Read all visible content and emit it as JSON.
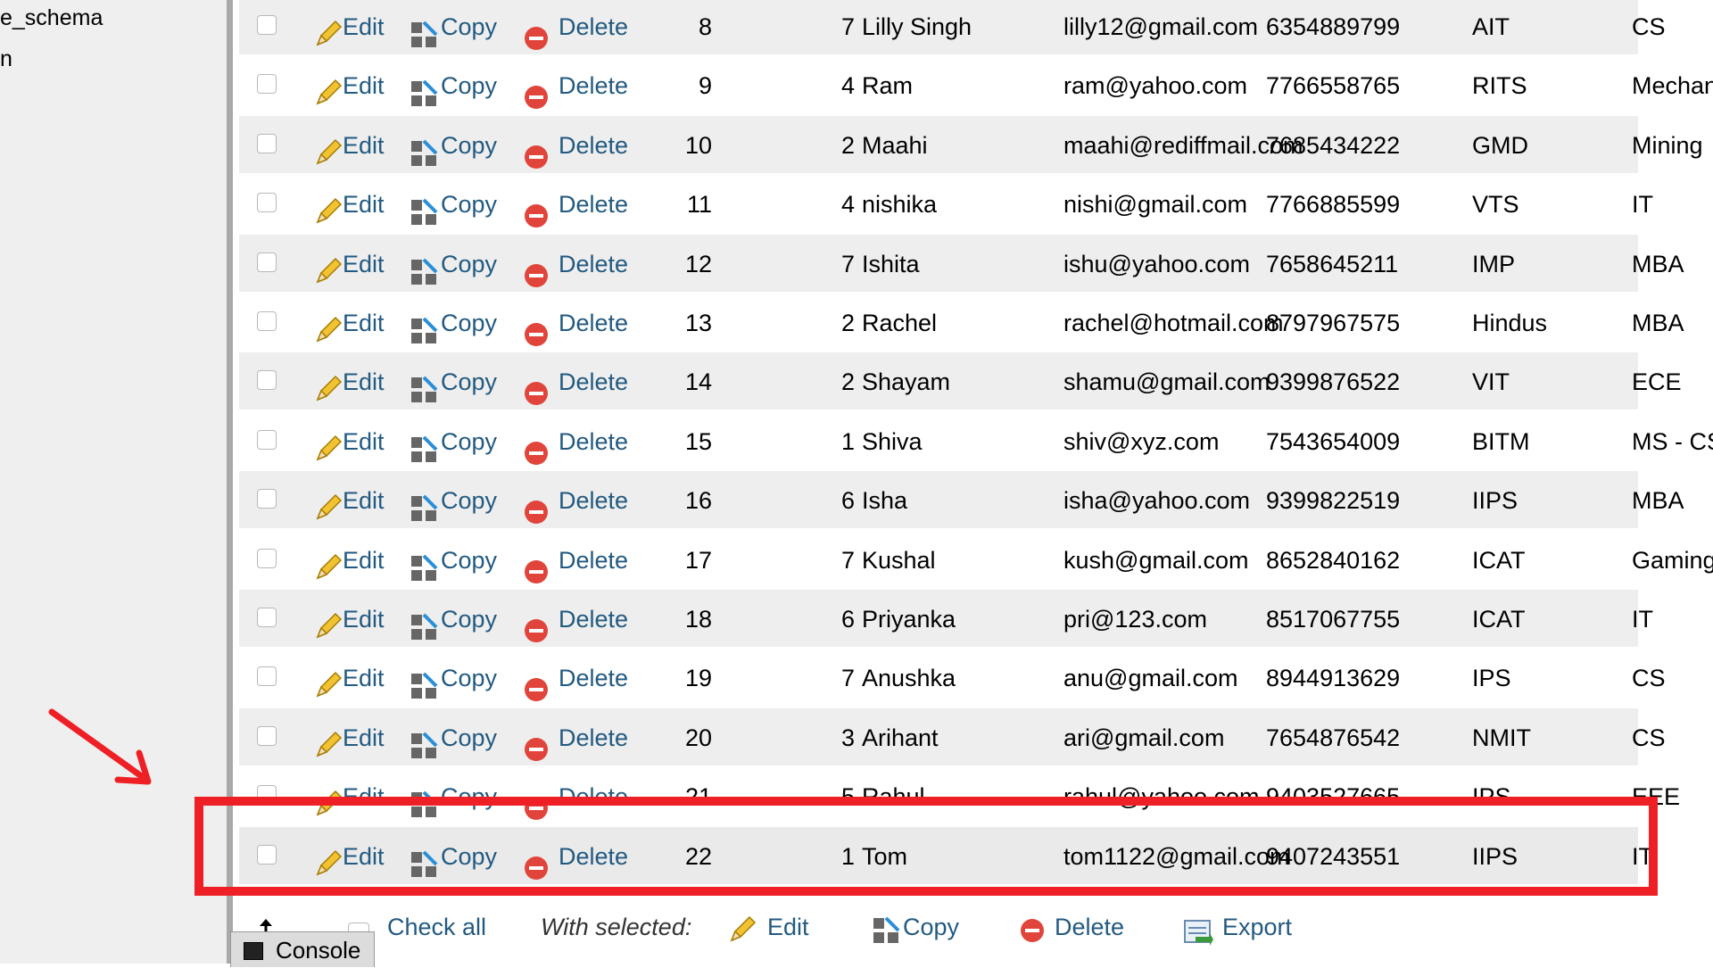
{
  "sidebar": {
    "items": [
      "e_schema",
      "n"
    ]
  },
  "actions": {
    "edit": "Edit",
    "copy": "Copy",
    "delete": "Delete"
  },
  "rows": [
    {
      "id": "8",
      "num": "7",
      "name": "Lilly Singh",
      "email": "lilly12@gmail.com",
      "phone": "6354889799",
      "college": "AIT",
      "branch": "CS"
    },
    {
      "id": "9",
      "num": "4",
      "name": "Ram",
      "email": "ram@yahoo.com",
      "phone": "7766558765",
      "college": "RITS",
      "branch": "Mechanical"
    },
    {
      "id": "10",
      "num": "2",
      "name": "Maahi",
      "email": "maahi@rediffmail.com",
      "phone": "7685434222",
      "college": "GMD",
      "branch": "Mining"
    },
    {
      "id": "11",
      "num": "4",
      "name": "nishika",
      "email": "nishi@gmail.com",
      "phone": "7766885599",
      "college": "VTS",
      "branch": "IT"
    },
    {
      "id": "12",
      "num": "7",
      "name": "Ishita",
      "email": "ishu@yahoo.com",
      "phone": "7658645211",
      "college": "IMP",
      "branch": "MBA"
    },
    {
      "id": "13",
      "num": "2",
      "name": "Rachel",
      "email": "rachel@hotmail.com",
      "phone": "8797967575",
      "college": "Hindus",
      "branch": "MBA"
    },
    {
      "id": "14",
      "num": "2",
      "name": "Shayam",
      "email": "shamu@gmail.com",
      "phone": "9399876522",
      "college": "VIT",
      "branch": "ECE"
    },
    {
      "id": "15",
      "num": "1",
      "name": "Shiva",
      "email": "shiv@xyz.com",
      "phone": "7543654009",
      "college": "BITM",
      "branch": "MS - CS"
    },
    {
      "id": "16",
      "num": "6",
      "name": "Isha",
      "email": "isha@yahoo.com",
      "phone": "9399822519",
      "college": "IIPS",
      "branch": "MBA"
    },
    {
      "id": "17",
      "num": "7",
      "name": "Kushal",
      "email": "kush@gmail.com",
      "phone": "8652840162",
      "college": "ICAT",
      "branch": "Gaming"
    },
    {
      "id": "18",
      "num": "6",
      "name": "Priyanka",
      "email": "pri@123.com",
      "phone": "8517067755",
      "college": "ICAT",
      "branch": "IT"
    },
    {
      "id": "19",
      "num": "7",
      "name": "Anushka",
      "email": "anu@gmail.com",
      "phone": "8944913629",
      "college": "IPS",
      "branch": "CS"
    },
    {
      "id": "20",
      "num": "3",
      "name": "Arihant",
      "email": "ari@gmail.com",
      "phone": "7654876542",
      "college": "NMIT",
      "branch": "CS"
    },
    {
      "id": "21",
      "num": "5",
      "name": "Rahul",
      "email": "rahul@yahoo.com",
      "phone": "9403527665",
      "college": "IPS",
      "branch": "EEE"
    },
    {
      "id": "22",
      "num": "1",
      "name": "Tom",
      "email": "tom1122@gmail.com",
      "phone": "9407243551",
      "college": "IIPS",
      "branch": "IT"
    }
  ],
  "bottom_bar": {
    "check_all": "Check all",
    "with_selected": "With selected:",
    "edit": "Edit",
    "copy": "Copy",
    "delete": "Delete",
    "export": "Export"
  },
  "console": {
    "label": "Console"
  },
  "colors": {
    "link": "#235a81",
    "highlight_box": "#ee2026",
    "arrow": "#ee2026",
    "delete_icon": "#e0443a"
  }
}
